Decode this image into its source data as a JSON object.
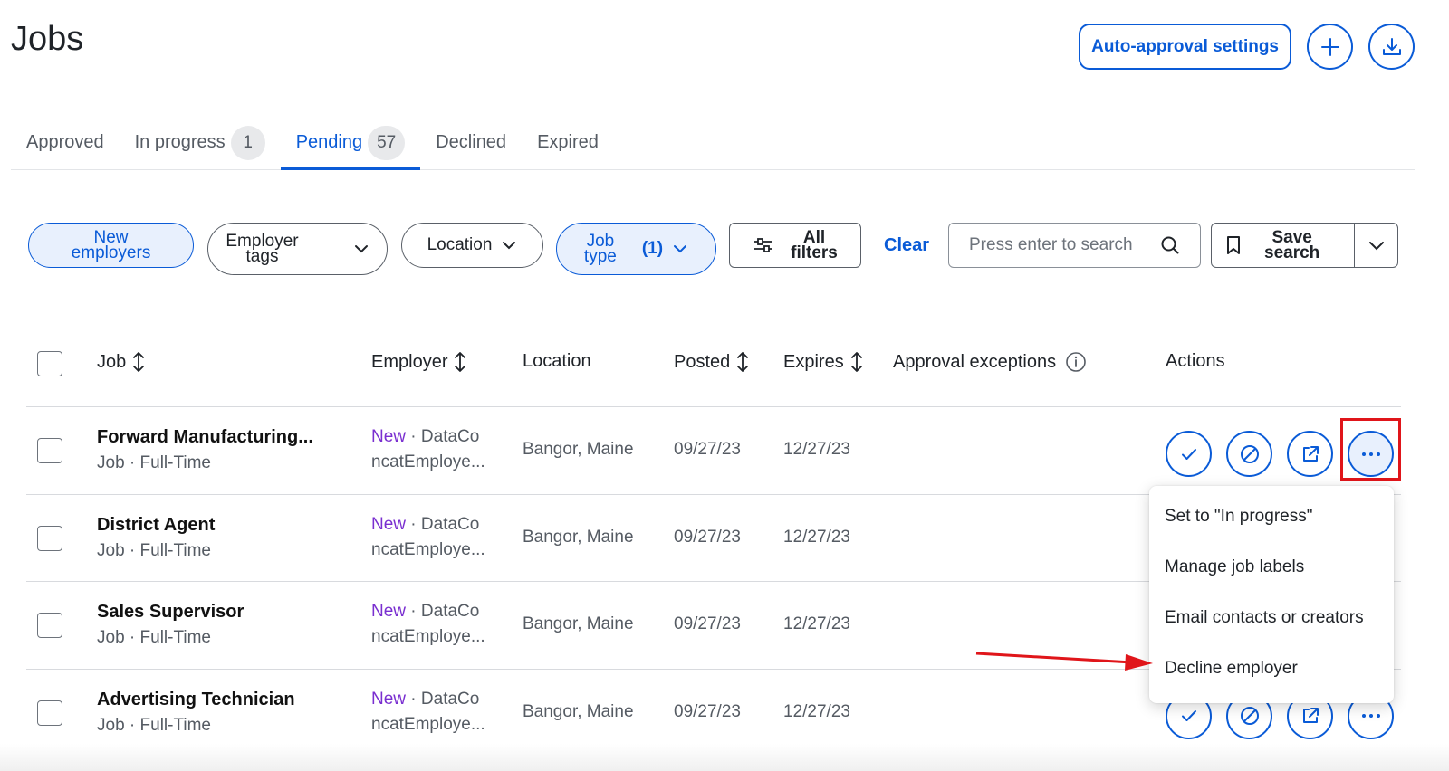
{
  "page": {
    "title": "Jobs"
  },
  "header_actions": {
    "auto_approval_label": "Auto-approval settings",
    "add_icon": "plus-icon",
    "download_icon": "download-icon"
  },
  "tabs": [
    {
      "label": "Approved",
      "count": ""
    },
    {
      "label": "In progress",
      "count": "1"
    },
    {
      "label": "Pending",
      "count": "57",
      "active": true
    },
    {
      "label": "Declined",
      "count": ""
    },
    {
      "label": "Expired",
      "count": ""
    }
  ],
  "filters": {
    "new_employers_1": "New",
    "new_employers_2": "employers",
    "employer_tags_1": "Employer",
    "employer_tags_2": "tags",
    "location": "Location",
    "job_type_1": "Job",
    "job_type_2": "type",
    "job_type_count": "(1)",
    "all_filters_1": "All",
    "all_filters_2": "filters",
    "clear": "Clear",
    "search_placeholder": "Press enter to search",
    "save_search_1": "Save",
    "save_search_2": "search"
  },
  "table": {
    "headers": {
      "job": "Job",
      "employer": "Employer",
      "location": "Location",
      "posted": "Posted",
      "expires": "Expires",
      "approval_exceptions": "Approval exceptions",
      "actions": "Actions"
    },
    "rows": [
      {
        "title": "Forward Manufacturing...",
        "meta": "Job · Full-Time",
        "new": "New",
        "employer_line1": " · DataCo",
        "employer_line2": "ncatEmploye...",
        "location": "Bangor, Maine",
        "posted": "09/27/23",
        "expires": "12/27/23"
      },
      {
        "title": "District Agent",
        "meta": "Job · Full-Time",
        "new": "New",
        "employer_line1": " · DataCo",
        "employer_line2": "ncatEmploye...",
        "location": "Bangor, Maine",
        "posted": "09/27/23",
        "expires": "12/27/23"
      },
      {
        "title": "Sales Supervisor",
        "meta": "Job · Full-Time",
        "new": "New",
        "employer_line1": " · DataCo",
        "employer_line2": "ncatEmploye...",
        "location": "Bangor, Maine",
        "posted": "09/27/23",
        "expires": "12/27/23"
      },
      {
        "title": "Advertising Technician",
        "meta": "Job · Full-Time",
        "new": "New",
        "employer_line1": " · DataCo",
        "employer_line2": "ncatEmploye...",
        "location": "Bangor, Maine",
        "posted": "09/27/23",
        "expires": "12/27/23"
      }
    ]
  },
  "more_menu": {
    "items": [
      "Set to \"In progress\"",
      "Manage job labels",
      "Email contacts or creators",
      "Decline employer"
    ]
  },
  "colors": {
    "accent": "#0a5bd7",
    "new_tag": "#7a2fd0",
    "annotation_red": "#e0151a"
  }
}
